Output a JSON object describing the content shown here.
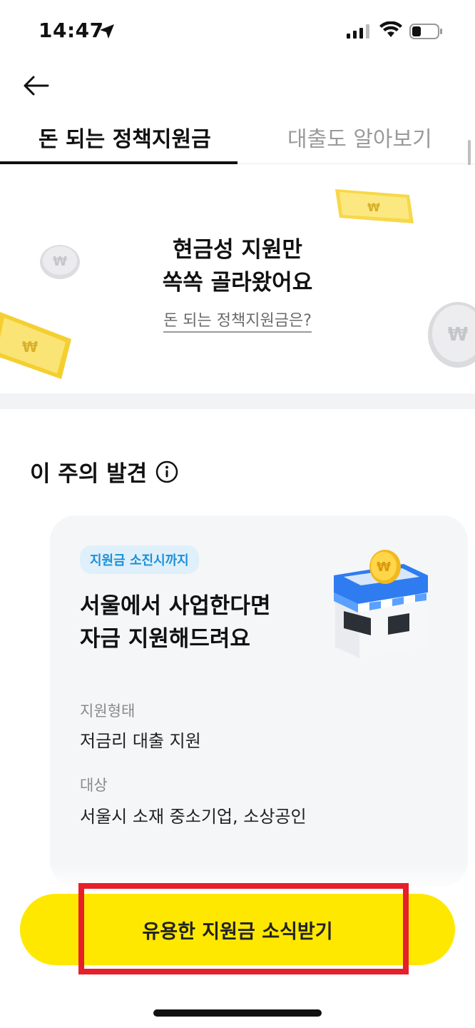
{
  "status": {
    "time": "14:47"
  },
  "header": {
    "tabs": [
      {
        "label": "돈 되는 정책지원금",
        "active": true
      },
      {
        "label": "대출도 알아보기",
        "active": false
      }
    ]
  },
  "banner": {
    "title_line1": "현금성 지원만",
    "title_line2": "쏙쏙 골라왔어요",
    "link": "돈 되는 정책지원금은?"
  },
  "section": {
    "title": "이 주의 발견"
  },
  "card": {
    "badge": "지원금 소진시까지",
    "title_line1": "서울에서 사업한다면",
    "title_line2": "자금 지원해드려요",
    "support_type_label": "지원형태",
    "support_type_value": "저금리 대출 지원",
    "target_label": "대상",
    "target_value": "서울시 소재 중소기업, 소상공인"
  },
  "cta": {
    "label": "유용한 지원금 소식받기"
  },
  "colors": {
    "accent": "#ffe800",
    "highlight": "#e5202a",
    "badge_text": "#1d8fd6"
  }
}
